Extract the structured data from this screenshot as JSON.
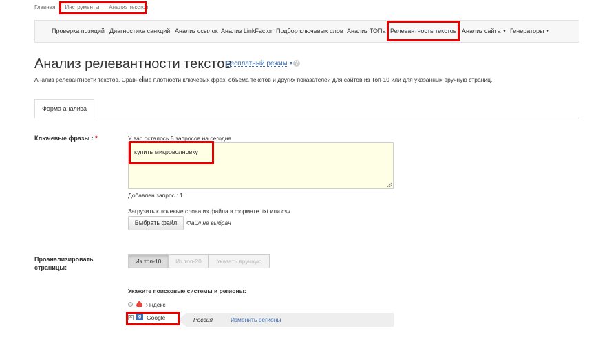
{
  "breadcrumb": {
    "home": "Главная",
    "tools": "Инструменты",
    "arrow": "→",
    "current": "Анализ текстов"
  },
  "nav": {
    "items": [
      {
        "label": "Проверка позиций"
      },
      {
        "label": "Диагностика санкций"
      },
      {
        "label": "Анализ ссылок"
      },
      {
        "label": "Анализ LinkFactor"
      },
      {
        "label": "Подбор ключевых слов"
      },
      {
        "label": "Анализ ТОПа"
      },
      {
        "label": "Релевантность текстов"
      },
      {
        "label": "Анализ сайта"
      },
      {
        "label": "Генераторы"
      }
    ]
  },
  "page": {
    "title": "Анализ релевантности текстов",
    "mode": "Бесплатный режим",
    "help": "?",
    "description": "Анализ релевантности текстов. Сравнение плотности ключевых фраз, объема текстов и других показателей для сайтов из Топ-10 или для указанных вручную страниц."
  },
  "tabs": {
    "form": "Форма анализа"
  },
  "form": {
    "keywords_label": "Ключевые фразы :",
    "required_mark": "*",
    "requests_left": "У вас осталось 5 запросов на сегодня",
    "keywords_value": "купить микроволновку",
    "added": "Добавлен запрос : 1",
    "upload_hint": "Загрузить ключевые слова из файла в формате .txt или csv",
    "choose_file": "Выбрать файл",
    "no_file": "Файл не выбран",
    "analyze_label_1": "Проанализировать",
    "analyze_label_2": "страницы:",
    "segments": [
      "Из топ-10",
      "Из топ-20",
      "Указать вручную"
    ],
    "engines_title": "Укажите поисковые системы и регионы:",
    "yandex": "Яндекс",
    "google": "Google",
    "google_checked": "✕",
    "region": "Россия",
    "change_regions": "Изменить регионы"
  },
  "colors": {
    "highlight": "#e60000",
    "link": "#3b6fb5",
    "textarea_bg": "#ffffe6"
  }
}
